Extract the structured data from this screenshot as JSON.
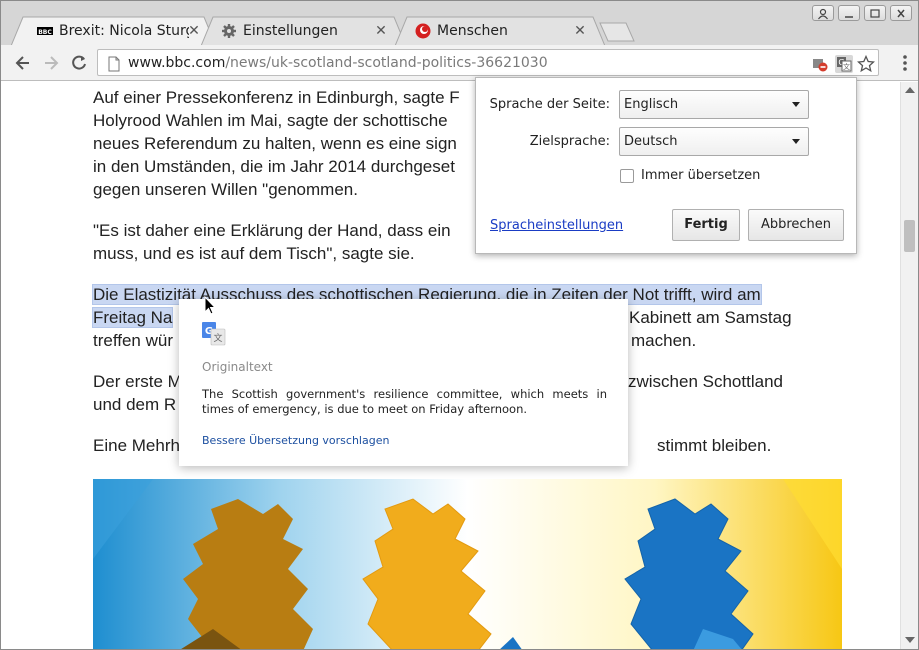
{
  "tabs": [
    {
      "title": "Brexit: Nicola Sturg",
      "favicon": "bbc-icon",
      "active": true
    },
    {
      "title": "Einstellungen",
      "favicon": "gear-icon",
      "active": false
    },
    {
      "title": "Menschen",
      "favicon": "menschen-icon",
      "active": false
    }
  ],
  "address_bar": {
    "host": "www.bbc.com",
    "path": "/news/uk-scotland-scotland-politics-36621030"
  },
  "article": {
    "p1": "Auf einer Pressekonferenz in Edinburgh, sagte F",
    "p1b": "Holyrood Wahlen im Mai, sagte der schottische",
    "p1c": "neues Referendum zu halten, wenn es eine sign",
    "p1d": "in den Umständen, die im Jahr 2014 durchgeset",
    "p1e": "gegen unseren Willen \"genommen.",
    "p2a": "\"Es ist daher eine Erklärung der Hand, dass ein",
    "p2b": "muss, und es ist auf dem Tisch\", sagte sie.",
    "p3_highlight_line1": "Die Elastizität Ausschuss des schottischen Regierung, die in Zeiten der Not trifft, wird am",
    "p3_highlight_line2_start": "Freitag Na",
    "p3_line2_end": "Kabinett am Samstag",
    "p3_line3_start": "treffen wür",
    "p3_line3_end": "machen.",
    "p4_line1_start": "Der erste M",
    "p4_line1_end": "zwischen Schottland",
    "p4_line2_start": "und dem R",
    "p5_start": "Eine Mehrh",
    "p5_end": "stimmt bleiben."
  },
  "translate_bubble": {
    "source_label": "Sprache der Seite:",
    "source_value": "Englisch",
    "target_label": "Zielsprache:",
    "target_value": "Deutsch",
    "always_translate_label": "Immer übersetzen",
    "always_translate_checked": false,
    "language_settings_link": "Spracheinstellungen",
    "done_button": "Fertig",
    "cancel_button": "Abbrechen"
  },
  "original_text_popup": {
    "heading": "Originaltext",
    "text": "The Scottish government's resilience committee, which meets in times of emergency, is due to meet on Friday afternoon.",
    "suggest_link": "Bessere Übersetzung vorschlagen"
  },
  "colors": {
    "highlight": "#c9d7f2",
    "link": "#1a3cc4",
    "map_orange": "#f1ac1c",
    "map_blue": "#1a74c4"
  }
}
